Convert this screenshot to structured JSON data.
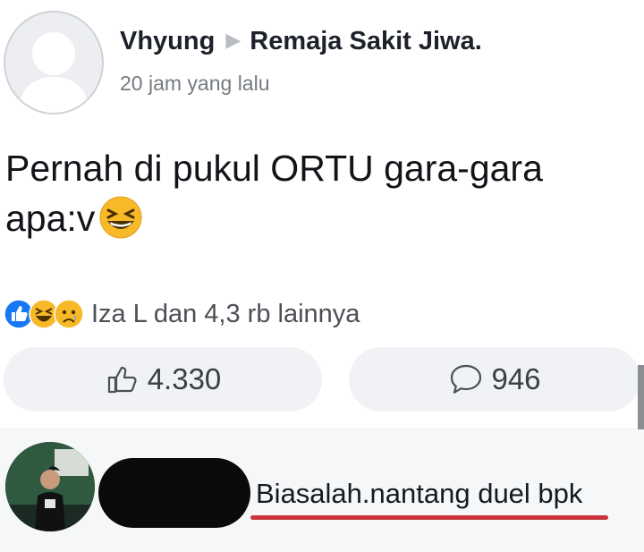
{
  "post": {
    "author": "Vhyung",
    "group": "Remaja Sakit Jiwa.",
    "timestamp": "20 jam yang lalu",
    "text": "Pernah di pukul ORTU gara-gara apa:v",
    "emoji_icon": "grinning-squinting-face-icon",
    "reactions": {
      "icons": [
        "like-icon",
        "haha-icon",
        "sad-icon"
      ],
      "summary": "Iza L dan 4,3 rb lainnya"
    },
    "like_count": "4.330",
    "comment_count": "946"
  },
  "comment": {
    "text": "Biasalah.nantang duel bpk",
    "underline_color": "#c9343b"
  },
  "colors": {
    "like_blue": "#1877f2",
    "emoji_yellow": "#f7b928"
  }
}
